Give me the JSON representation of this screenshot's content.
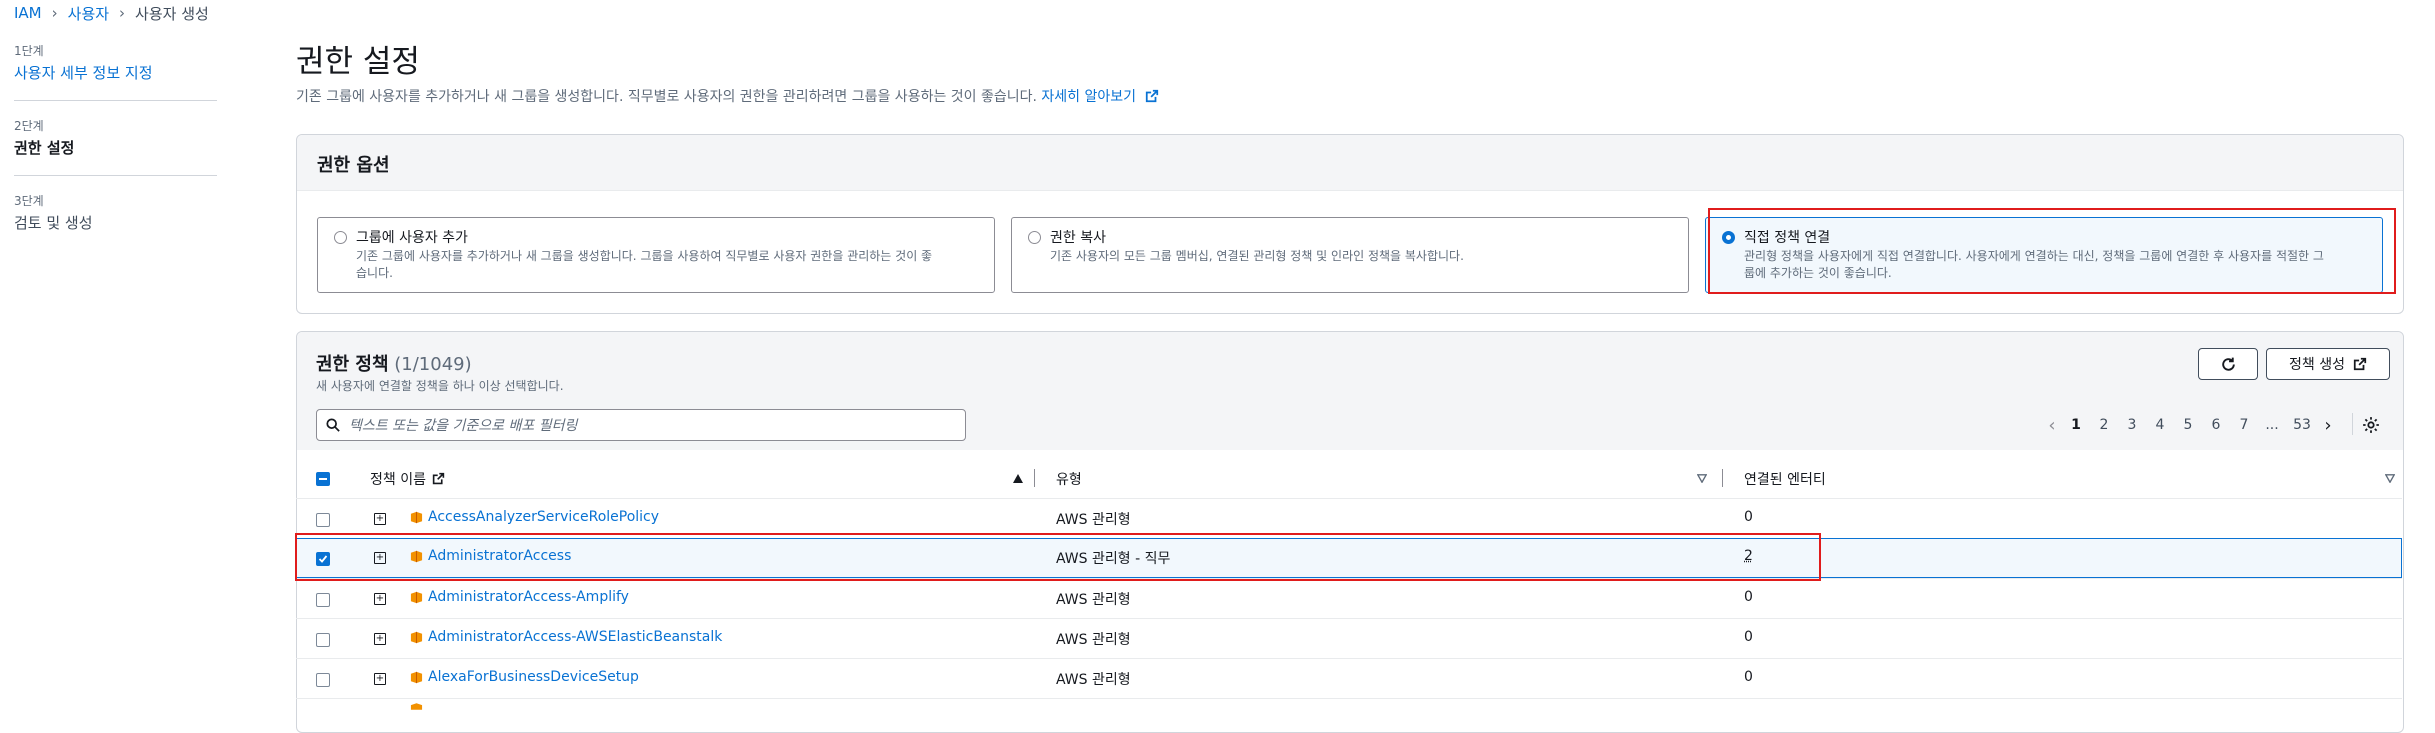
{
  "breadcrumb": [
    "IAM",
    "사용자",
    "사용자 생성"
  ],
  "steps": [
    {
      "num": "1단계",
      "label": "사용자 세부 정보 지정"
    },
    {
      "num": "2단계",
      "label": "권한 설정"
    },
    {
      "num": "3단계",
      "label": "검토 및 생성"
    }
  ],
  "header": {
    "title": "권한 설정",
    "description": "기존 그룹에 사용자를 추가하거나 새 그룹을 생성합니다. 직무별로 사용자의 권한을 관리하려면 그룹을 사용하는 것이 좋습니다.",
    "learn_more": "자세히 알아보기"
  },
  "options": {
    "heading": "권한 옵션",
    "items": [
      {
        "title": "그룹에 사용자 추가",
        "desc1": "기존 그룹에 사용자를 추가하거나 새 그룹을 생성합니다. 그룹을 사용하여 직무별로 사용자 권한을 관리하는 것이 좋",
        "desc2": "습니다."
      },
      {
        "title": "권한 복사",
        "desc1": "기존 사용자의 모든 그룹 멤버십, 연결된 관리형 정책 및 인라인 정책을 복사합니다.",
        "desc2": ""
      },
      {
        "title": "직접 정책 연결",
        "desc1": "관리형 정책을 사용자에게 직접 연결합니다. 사용자에게 연결하는 대신, 정책을 그룹에 연결한 후 사용자를 적절한 그",
        "desc2": "룹에 추가하는 것이 좋습니다."
      }
    ],
    "selected": "직접 정책 연결"
  },
  "policies": {
    "heading": "권한 정책",
    "count": "(1/1049)",
    "subtext": "새 사용자에 연결할 정책을 하나 이상 선택합니다.",
    "create_button": "정책 생성",
    "search_placeholder": "텍스트 또는 값을 기준으로 배포 필터링",
    "pages": [
      "1",
      "2",
      "3",
      "4",
      "5",
      "6",
      "7",
      "...",
      "53"
    ],
    "current_page": "1",
    "columns": [
      "정책 이름",
      "유형",
      "연결된 엔터티"
    ],
    "rows": [
      {
        "name": "AccessAnalyzerServiceRolePolicy",
        "type": "AWS 관리형",
        "entities": "0",
        "checked": false
      },
      {
        "name": "AdministratorAccess",
        "type": "AWS 관리형 - 직무",
        "entities": "2",
        "checked": true
      },
      {
        "name": "AdministratorAccess-Amplify",
        "type": "AWS 관리형",
        "entities": "0",
        "checked": false
      },
      {
        "name": "AdministratorAccess-AWSElasticBeanstalk",
        "type": "AWS 관리형",
        "entities": "0",
        "checked": false
      },
      {
        "name": "AlexaForBusinessDeviceSetup",
        "type": "AWS 관리형",
        "entities": "0",
        "checked": false
      }
    ]
  },
  "colors": {
    "accent": "#0972d3",
    "highlight": "#e01c1c",
    "policy_icon": "#f29100"
  }
}
